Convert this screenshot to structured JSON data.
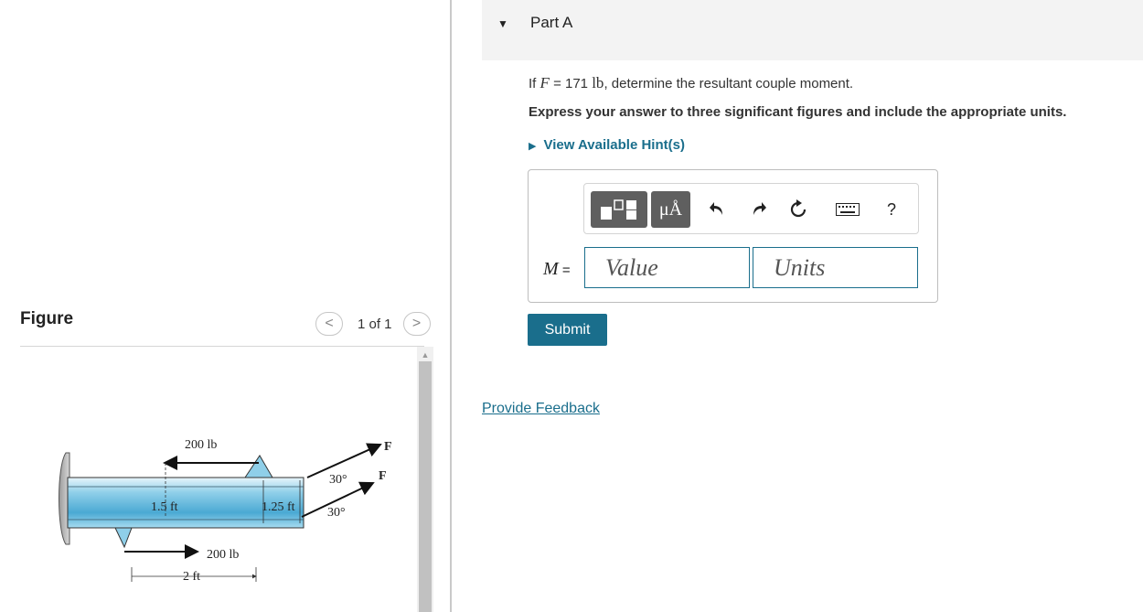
{
  "figure": {
    "title": "Figure",
    "pager": {
      "prev": "<",
      "next": ">",
      "text": "1 of 1"
    },
    "labels": {
      "force_top": "200 lb",
      "force_bottom": "200 lb",
      "dim_left": "1.5 ft",
      "dim_right": "1.25 ft",
      "dim_bottom": "2 ft",
      "angle_top": "30°",
      "angle_bottom": "30°",
      "f_top": "F",
      "f_bottom": "F"
    }
  },
  "part": {
    "title": "Part A"
  },
  "question": {
    "prefix": "If ",
    "var": "F",
    "eq": " = 171 ",
    "unit": "lb",
    "suffix": ", determine the resultant couple moment."
  },
  "instruction": "Express your answer to three significant figures and include the appropriate units.",
  "hint": "View Available Hint(s)",
  "answer": {
    "label": "M",
    "equals": " =",
    "value_placeholder": "Value",
    "units_placeholder": "Units",
    "toolbar": {
      "units_symbol": "μÅ",
      "help": "?"
    }
  },
  "submit_label": "Submit",
  "feedback_label": "Provide Feedback",
  "colors": {
    "accent": "#1a6e8c",
    "beam": "#7fc6e3"
  }
}
